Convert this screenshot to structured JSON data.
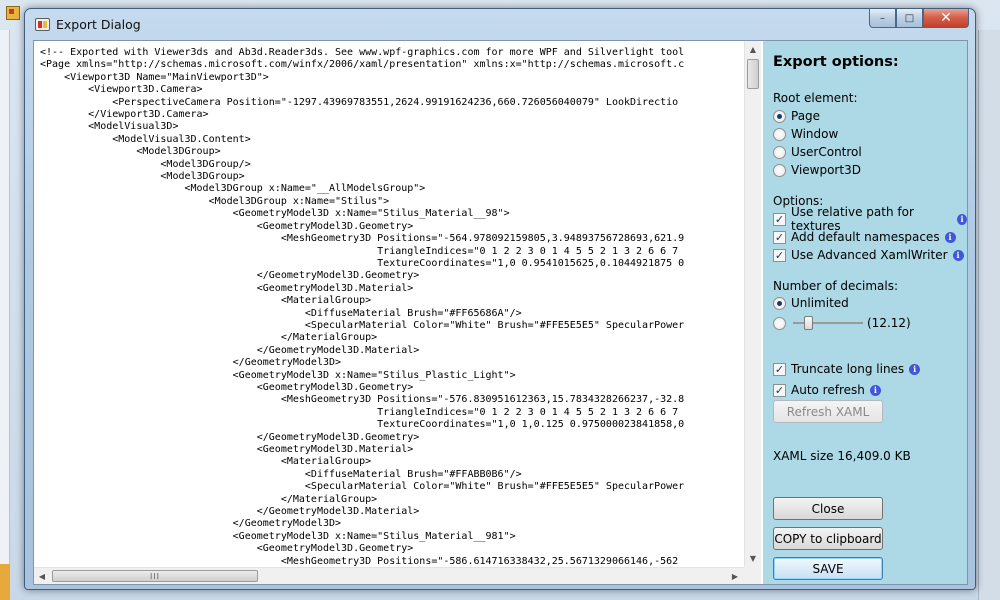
{
  "window": {
    "title": "Export Dialog"
  },
  "window_controls": {
    "minimize": "–",
    "maximize": "□",
    "close": "✕"
  },
  "code_lines": [
    "<!-- Exported with Viewer3ds and Ab3d.Reader3ds. See www.wpf-graphics.com for more WPF and Silverlight tool",
    "<Page xmlns=\"http://schemas.microsoft.com/winfx/2006/xaml/presentation\" xmlns:x=\"http://schemas.microsoft.c",
    "    <Viewport3D Name=\"MainViewport3D\">",
    "        <Viewport3D.Camera>",
    "            <PerspectiveCamera Position=\"-1297.43969783551,2624.99191624236,660.726056040079\" LookDirectio",
    "        </Viewport3D.Camera>",
    "        <ModelVisual3D>",
    "            <ModelVisual3D.Content>",
    "                <Model3DGroup>",
    "                    <Model3DGroup/>",
    "                    <Model3DGroup>",
    "                        <Model3DGroup x:Name=\"__AllModelsGroup\">",
    "                            <Model3DGroup x:Name=\"Stilus\">",
    "                                <GeometryModel3D x:Name=\"Stilus_Material__98\">",
    "                                    <GeometryModel3D.Geometry>",
    "                                        <MeshGeometry3D Positions=\"-564.978092159805,3.94893756728693,621.9",
    "                                                        TriangleIndices=\"0 1 2 2 3 0 1 4 5 5 2 1 3 2 6 6 7",
    "                                                        TextureCoordinates=\"1,0 0.9541015625,0.1044921875 0",
    "                                    </GeometryModel3D.Geometry>",
    "                                    <GeometryModel3D.Material>",
    "                                        <MaterialGroup>",
    "                                            <DiffuseMaterial Brush=\"#FF65686A\"/>",
    "                                            <SpecularMaterial Color=\"White\" Brush=\"#FFE5E5E5\" SpecularPower",
    "                                        </MaterialGroup>",
    "                                    </GeometryModel3D.Material>",
    "                                </GeometryModel3D>",
    "                                <GeometryModel3D x:Name=\"Stilus_Plastic_Light\">",
    "                                    <GeometryModel3D.Geometry>",
    "                                        <MeshGeometry3D Positions=\"-576.830951612363,15.7834328266237,-32.8",
    "                                                        TriangleIndices=\"0 1 2 2 3 0 1 4 5 5 2 1 3 2 6 6 7",
    "                                                        TextureCoordinates=\"1,0 1,0.125 0.975000023841858,0",
    "                                    </GeometryModel3D.Geometry>",
    "                                    <GeometryModel3D.Material>",
    "                                        <MaterialGroup>",
    "                                            <DiffuseMaterial Brush=\"#FFABB0B6\"/>",
    "                                            <SpecularMaterial Color=\"White\" Brush=\"#FFE5E5E5\" SpecularPower",
    "                                        </MaterialGroup>",
    "                                    </GeometryModel3D.Material>",
    "                                </GeometryModel3D>",
    "                                <GeometryModel3D x:Name=\"Stilus_Material__981\">",
    "                                    <GeometryModel3D.Geometry>",
    "                                        <MeshGeometry3D Positions=\"-586.614716338432,25.5671329066146,-562"
  ],
  "options": {
    "title": "Export options:",
    "root_label": "Root element:",
    "root_items": [
      {
        "label": "Page",
        "selected": true
      },
      {
        "label": "Window",
        "selected": false
      },
      {
        "label": "UserControl",
        "selected": false
      },
      {
        "label": "Viewport3D",
        "selected": false
      }
    ],
    "options_label": "Options:",
    "checks": [
      {
        "label": "Use relative path for textures",
        "checked": true
      },
      {
        "label": "Add default namespaces",
        "checked": true
      },
      {
        "label": "Use Advanced XamlWriter",
        "checked": true
      }
    ],
    "decimals_label": "Number of decimals:",
    "decimals_unlimited": "Unlimited",
    "slider_value_text": "(12.12)",
    "slider_fraction": 0.18,
    "truncate_label": "Truncate long lines",
    "auto_refresh_label": "Auto refresh",
    "refresh_button": "Refresh XAML",
    "xaml_size": "XAML size 16,409.0 KB",
    "close_button": "Close",
    "copy_button": "COPY to clipboard",
    "save_button": "SAVE"
  },
  "scroll": {
    "up": "▲",
    "down": "▼",
    "left": "◀",
    "right": "▶",
    "grip_h": "III",
    "grip_v": "≡"
  },
  "info_glyph": "i",
  "check_glyph": "✓",
  "colors": {
    "options_bg": "#add8e6",
    "info_icon": "#3f57d8",
    "close_button": "#c2402a"
  }
}
